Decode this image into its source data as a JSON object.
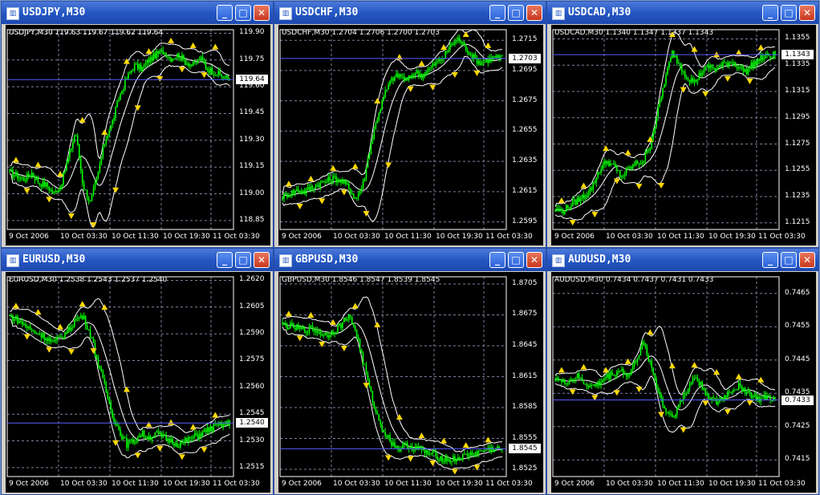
{
  "windows": [
    {
      "title": "USDJPY,M30",
      "symbol_label": "USDJPY,M30  119.63 119.67 119.62 119.64",
      "current_price": "119.64",
      "chart_data": {
        "type": "candlestick",
        "symbol": "USDJPY",
        "timeframe": "M30",
        "ohlc": {
          "open": 119.63,
          "high": 119.67,
          "low": 119.62,
          "close": 119.64
        },
        "ylim": [
          118.8,
          119.92
        ],
        "y_ticks": [
          "119.90",
          "119.75",
          "119.60",
          "119.45",
          "119.30",
          "119.15",
          "119.00",
          "118.85"
        ],
        "x_ticks": [
          "9 Oct 2006",
          "10 Oct 03:30",
          "10 Oct 11:30",
          "10 Oct 19:30",
          "11 Oct 03:30"
        ],
        "current_price": 119.64,
        "path": [
          119.12,
          119.1,
          119.08,
          119.12,
          119.06,
          119.05,
          119.0,
          119.05,
          119.2,
          119.35,
          119.05,
          118.95,
          119.1,
          119.3,
          119.4,
          119.55,
          119.65,
          119.72,
          119.7,
          119.75,
          119.78,
          119.8,
          119.76,
          119.78,
          119.74,
          119.72,
          119.76,
          119.7,
          119.68,
          119.66,
          119.64
        ]
      }
    },
    {
      "title": "USDCHF,M30",
      "symbol_label": "USDCHF,M30  1.2704 1.2706 1.2700 1.2703",
      "current_price": "1.2703",
      "chart_data": {
        "type": "candlestick",
        "symbol": "USDCHF",
        "timeframe": "M30",
        "ohlc": {
          "open": 1.2704,
          "high": 1.2706,
          "low": 1.27,
          "close": 1.2703
        },
        "ylim": [
          1.259,
          1.2722
        ],
        "y_ticks": [
          "1.2715",
          "1.2695",
          "1.2675",
          "1.2655",
          "1.2635",
          "1.2615",
          "1.2595"
        ],
        "x_ticks": [
          "9 Oct 2006",
          "10 Oct 03:30",
          "10 Oct 11:30",
          "10 Oct 19:30",
          "11 Oct 03:30"
        ],
        "current_price": 1.2703,
        "path": [
          1.2612,
          1.2614,
          1.2616,
          1.2615,
          1.2618,
          1.262,
          1.2622,
          1.2624,
          1.2622,
          1.2618,
          1.261,
          1.262,
          1.2645,
          1.2665,
          1.268,
          1.269,
          1.2692,
          1.2688,
          1.2694,
          1.2692,
          1.2696,
          1.27,
          1.2704,
          1.2712,
          1.2716,
          1.271,
          1.2704,
          1.27,
          1.2702,
          1.2704,
          1.2703
        ]
      }
    },
    {
      "title": "USDCAD,M30",
      "symbol_label": "USDCAD,M30  1.1340 1.1347 1.1337 1.1343",
      "current_price": "1.1343",
      "chart_data": {
        "type": "candlestick",
        "symbol": "USDCAD",
        "timeframe": "M30",
        "ohlc": {
          "open": 1.134,
          "high": 1.1347,
          "low": 1.1337,
          "close": 1.1343
        },
        "ylim": [
          1.121,
          1.1362
        ],
        "y_ticks": [
          "1.1355",
          "1.1335",
          "1.1315",
          "1.1295",
          "1.1275",
          "1.1255",
          "1.1235",
          "1.1215"
        ],
        "x_ticks": [
          "9 Oct 2006",
          "10 Oct 03:30",
          "10 Oct 11:30",
          "10 Oct 19:30",
          "11 Oct 03:30"
        ],
        "current_price": 1.1343,
        "path": [
          1.1225,
          1.1224,
          1.1228,
          1.1232,
          1.1236,
          1.1242,
          1.1255,
          1.1262,
          1.1258,
          1.125,
          1.1256,
          1.126,
          1.1262,
          1.1275,
          1.13,
          1.1325,
          1.1345,
          1.1335,
          1.1326,
          1.1322,
          1.133,
          1.1334,
          1.1332,
          1.1336,
          1.1338,
          1.1334,
          1.133,
          1.1336,
          1.134,
          1.1342,
          1.1343
        ]
      }
    },
    {
      "title": "EURUSD,M30",
      "symbol_label": "EURUSD,M30  1.2538 1.2543 1.2537 1.2540",
      "current_price": "1.2540",
      "chart_data": {
        "type": "candlestick",
        "symbol": "EURUSD",
        "timeframe": "M30",
        "ohlc": {
          "open": 1.2538,
          "high": 1.2543,
          "low": 1.2537,
          "close": 1.254
        },
        "ylim": [
          1.251,
          1.2622
        ],
        "y_ticks": [
          "1.2620",
          "1.2605",
          "1.2590",
          "1.2575",
          "1.2560",
          "1.2545",
          "1.2530",
          "1.2515"
        ],
        "x_ticks": [
          "9 Oct 2006",
          "10 Oct 03:30",
          "10 Oct 11:30",
          "10 Oct 19:30",
          "11 Oct 03:30"
        ],
        "current_price": 1.254,
        "path": [
          1.26,
          1.2598,
          1.2595,
          1.2592,
          1.259,
          1.2588,
          1.2585,
          1.2588,
          1.2592,
          1.2598,
          1.26,
          1.259,
          1.2575,
          1.256,
          1.2545,
          1.2535,
          1.2528,
          1.253,
          1.2534,
          1.2532,
          1.2534,
          1.2532,
          1.253,
          1.2528,
          1.253,
          1.2532,
          1.2534,
          1.2536,
          1.2538,
          1.2539,
          1.254
        ]
      }
    },
    {
      "title": "GBPUSD,M30",
      "symbol_label": "GBPUSD,M30  1.8546 1.8547 1.8539 1.8545",
      "current_price": "1.8545",
      "chart_data": {
        "type": "candlestick",
        "symbol": "GBPUSD",
        "timeframe": "M30",
        "ohlc": {
          "open": 1.8546,
          "high": 1.8547,
          "low": 1.8539,
          "close": 1.8545
        },
        "ylim": [
          1.8518,
          1.8712
        ],
        "y_ticks": [
          "1.8705",
          "1.8675",
          "1.8645",
          "1.8615",
          "1.8585",
          "1.8555",
          "1.8525"
        ],
        "x_ticks": [
          "9 Oct 2006",
          "10 Oct 03:30",
          "10 Oct 11:30",
          "10 Oct 19:30",
          "11 Oct 03:30"
        ],
        "current_price": 1.8545,
        "path": [
          1.8665,
          1.8664,
          1.8662,
          1.866,
          1.8662,
          1.8658,
          1.8655,
          1.866,
          1.8665,
          1.8675,
          1.866,
          1.863,
          1.86,
          1.8575,
          1.856,
          1.855,
          1.8545,
          1.8548,
          1.8546,
          1.8544,
          1.854,
          1.8538,
          1.8535,
          1.8534,
          1.8536,
          1.8538,
          1.854,
          1.8542,
          1.8544,
          1.8545,
          1.8545
        ]
      }
    },
    {
      "title": "AUDUSD,M30",
      "symbol_label": "AUDUSD,M30  0.7434 0.7437 0.7431 0.7433",
      "current_price": "0.7433",
      "chart_data": {
        "type": "candlestick",
        "symbol": "AUDUSD",
        "timeframe": "M30",
        "ohlc": {
          "open": 0.7434,
          "high": 0.7437,
          "low": 0.7431,
          "close": 0.7433
        },
        "ylim": [
          0.741,
          0.747
        ],
        "y_ticks": [
          "0.7465",
          "0.7455",
          "0.7445",
          "0.7435",
          "0.7425",
          "0.7415"
        ],
        "x_ticks": [
          "9 Oct 2006",
          "10 Oct 03:30",
          "10 Oct 11:30",
          "10 Oct 19:30",
          "11 Oct 03:30"
        ],
        "current_price": 0.7433,
        "path": [
          0.744,
          0.7438,
          0.7439,
          0.744,
          0.7438,
          0.7437,
          0.7438,
          0.744,
          0.7441,
          0.7442,
          0.744,
          0.7445,
          0.745,
          0.7444,
          0.7436,
          0.743,
          0.7428,
          0.7432,
          0.7436,
          0.744,
          0.7437,
          0.7434,
          0.7432,
          0.7434,
          0.7436,
          0.7437,
          0.7436,
          0.7434,
          0.7433,
          0.7434,
          0.7433
        ]
      }
    }
  ],
  "colors": {
    "candle": "#00ff00",
    "chart_bg": "#000000",
    "grid": "#8080a0",
    "fractal": "#ffd800",
    "band": "#ffffff",
    "price_line": "#5a5aff",
    "titlebar": "#2457c4",
    "desktop": "#7d9bc9"
  }
}
